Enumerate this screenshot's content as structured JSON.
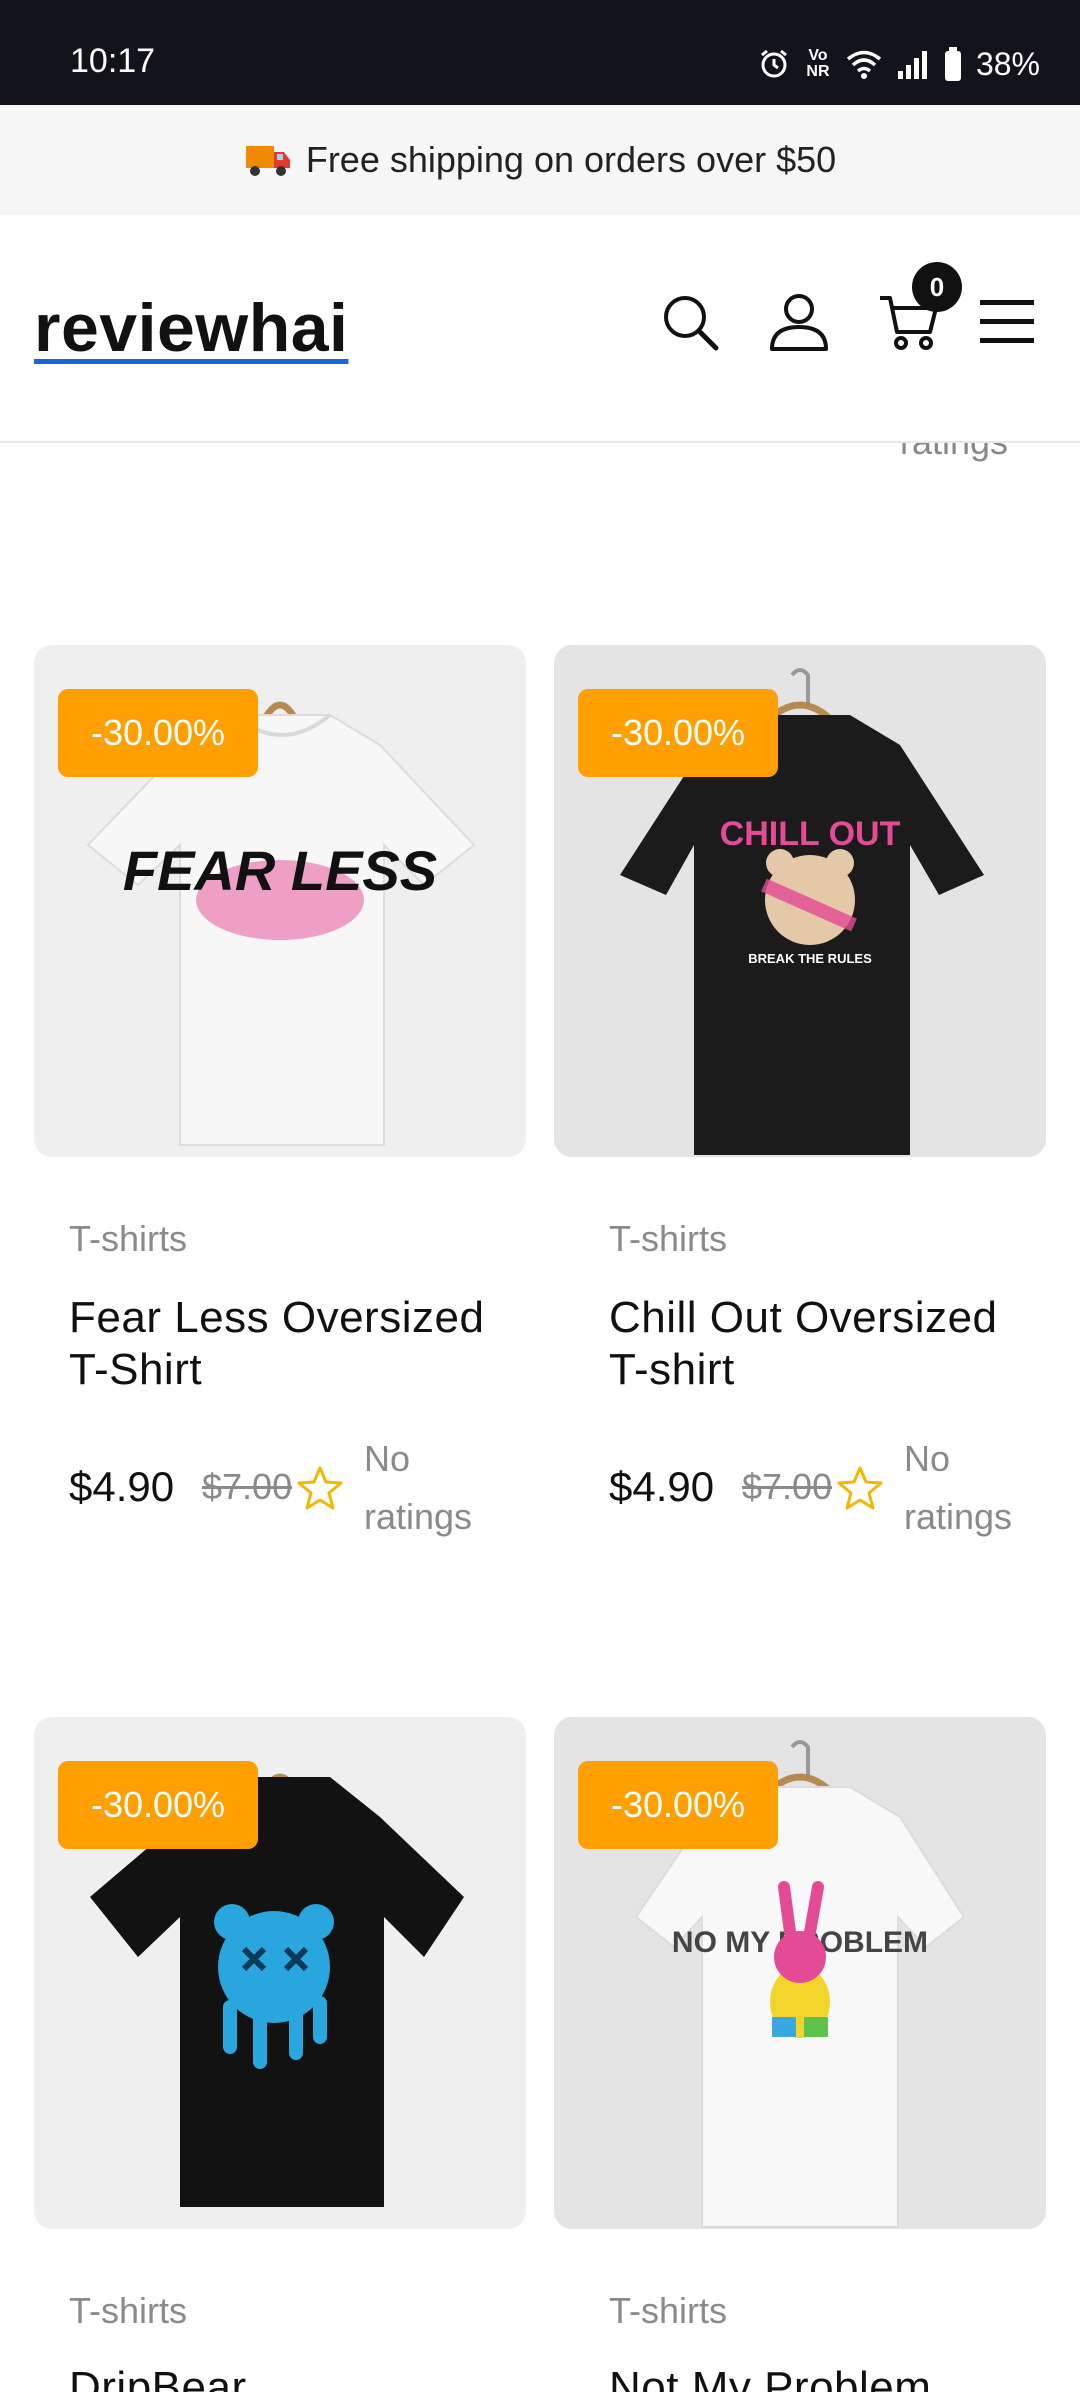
{
  "status_bar": {
    "time": "10:17",
    "volte": "Vo NR",
    "battery": "38%"
  },
  "promo": {
    "icon": "delivery-truck-icon",
    "text": "Free shipping on orders over $50"
  },
  "header": {
    "logo": "reviewhai",
    "cart_count": "0",
    "icons": [
      "search-icon",
      "user-icon",
      "cart-icon",
      "menu-icon"
    ]
  },
  "partial_prev": {
    "ratings_fragment": "ratings"
  },
  "products": [
    {
      "badge": "-30.00%",
      "category": "T-shirts",
      "title": "Fear Less Oversized T-Shirt",
      "price": "$4.90",
      "old_price": "$7.00",
      "rating": "No ratings",
      "shirt_color": "white",
      "graphic_text": "FEAR LESS"
    },
    {
      "badge": "-30.00%",
      "category": "T-shirts",
      "title": "Chill Out Oversized T-shirt",
      "price": "$4.90",
      "old_price": "$7.00",
      "rating": "No ratings",
      "shirt_color": "black",
      "graphic_text": "CHILL OUT",
      "graphic_subtext": "BREAK THE RULES"
    },
    {
      "badge": "-30.00%",
      "category": "T-shirts",
      "title": "DripBear",
      "shirt_color": "black"
    },
    {
      "badge": "-30.00%",
      "category": "T-shirts",
      "title": "Not My Problem",
      "shirt_color": "white",
      "graphic_text": "NO MY PROBLEM"
    }
  ],
  "colors": {
    "badge": "#ff9f00",
    "accent_underline": "#1a66d6",
    "star": "#f2b705"
  }
}
